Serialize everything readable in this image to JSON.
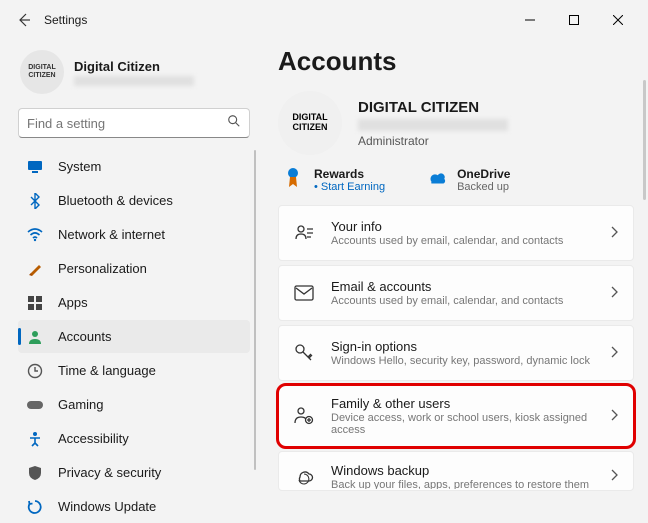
{
  "window": {
    "title": "Settings"
  },
  "user": {
    "name": "Digital Citizen",
    "avatar_text": "DIGITAL\nCITIZEN"
  },
  "search": {
    "placeholder": "Find a setting"
  },
  "sidebar": {
    "items": [
      {
        "label": "System",
        "icon": "system",
        "color": "#0067c0"
      },
      {
        "label": "Bluetooth & devices",
        "icon": "bluetooth",
        "color": "#0067c0"
      },
      {
        "label": "Network & internet",
        "icon": "wifi",
        "color": "#0067c0"
      },
      {
        "label": "Personalization",
        "icon": "brush",
        "color": "#b85c00"
      },
      {
        "label": "Apps",
        "icon": "apps",
        "color": "#444"
      },
      {
        "label": "Accounts",
        "icon": "person",
        "color": "#2e9e5b",
        "active": true
      },
      {
        "label": "Time & language",
        "icon": "clock",
        "color": "#555"
      },
      {
        "label": "Gaming",
        "icon": "gaming",
        "color": "#666"
      },
      {
        "label": "Accessibility",
        "icon": "access",
        "color": "#0067c0"
      },
      {
        "label": "Privacy & security",
        "icon": "shield",
        "color": "#555"
      },
      {
        "label": "Windows Update",
        "icon": "update",
        "color": "#0067c0"
      }
    ]
  },
  "page": {
    "title": "Accounts",
    "profile": {
      "name": "DIGITAL CITIZEN",
      "role": "Administrator",
      "avatar_text": "DIGITAL\nCITIZEN"
    },
    "quick": [
      {
        "icon": "rewards",
        "title": "Rewards",
        "sub": "Start Earning",
        "link": true
      },
      {
        "icon": "onedrive",
        "title": "OneDrive",
        "sub": "Backed up",
        "link": false
      }
    ],
    "cards": [
      {
        "icon": "userinfo",
        "title": "Your info",
        "desc": "Accounts used by email, calendar, and contacts"
      },
      {
        "icon": "email",
        "title": "Email & accounts",
        "desc": "Accounts used by email, calendar, and contacts"
      },
      {
        "icon": "key",
        "title": "Sign-in options",
        "desc": "Windows Hello, security key, password, dynamic lock"
      },
      {
        "icon": "family",
        "title": "Family & other users",
        "desc": "Device access, work or school users, kiosk assigned access",
        "highlight": true
      },
      {
        "icon": "backup",
        "title": "Windows backup",
        "desc": "Back up your files, apps, preferences to restore them across",
        "cut": true
      }
    ]
  }
}
